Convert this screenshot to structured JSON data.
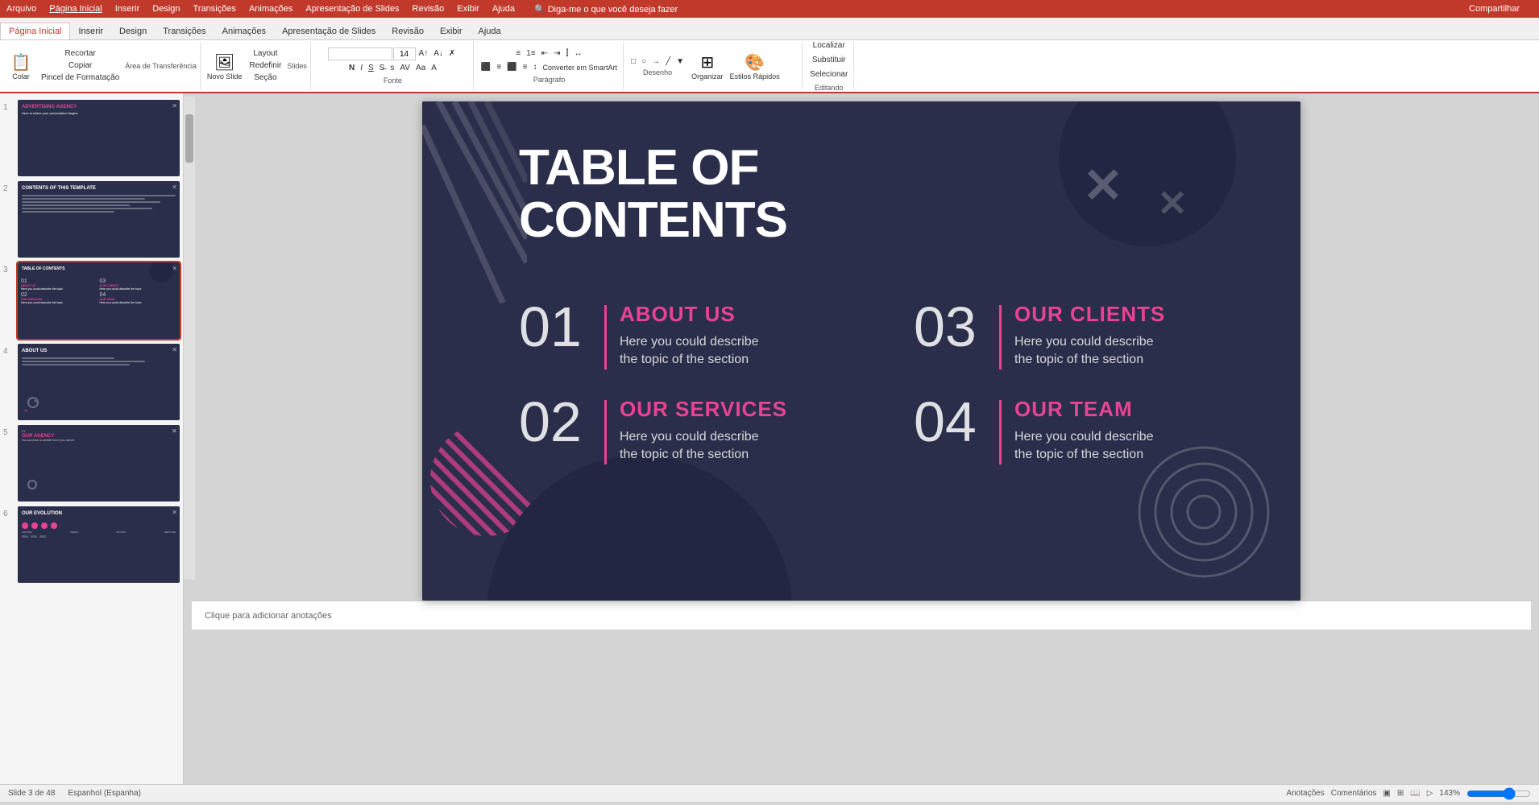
{
  "app": {
    "title": "PowerPoint",
    "menu_items": [
      "Arquivo",
      "Página Inicial",
      "Inserir",
      "Design",
      "Transições",
      "Animações",
      "Apresentação de Slides",
      "Revisão",
      "Exibir",
      "Ajuda",
      "Diga-me o que você deseja fazer"
    ],
    "share_label": "Compartilhar"
  },
  "ribbon": {
    "active_tab": "Página Inicial",
    "tabs": [
      "Arquivo",
      "Página Inicial",
      "Inserir",
      "Design",
      "Transições",
      "Animações",
      "Apresentação de Slides",
      "Revisão",
      "Exibir",
      "Ajuda"
    ],
    "clipboard": {
      "label": "Área de Transferência",
      "paste": "Colar",
      "cut": "Recortar",
      "copy": "Copiar",
      "format_painter": "Pincel de Formatação"
    },
    "slides": {
      "label": "Slides",
      "new_slide": "Novo Slide",
      "layout": "Layout",
      "reset": "Redefinir",
      "section": "Seção"
    },
    "font": {
      "label": "Fonte",
      "name": "",
      "size": "14",
      "bold": "N",
      "italic": "I",
      "underline": "S",
      "strikethrough": "S",
      "shadow": "s",
      "spacing": "Aa",
      "change_case": "Aa",
      "clear": "A",
      "color": "A"
    },
    "paragraph": {
      "label": "Parágrafo"
    },
    "drawing": {
      "label": "Desenho",
      "organize": "Organizar",
      "quick_styles": "Estilos Rápidos"
    },
    "editing": {
      "label": "Editando",
      "find": "Localizar",
      "replace": "Substituir",
      "select": "Selecionar"
    }
  },
  "slides": [
    {
      "number": "1",
      "title": "ADVERTISING AGENCY",
      "subtitle": "Here is where your presentation begins",
      "active": false
    },
    {
      "number": "2",
      "title": "CONTENTS OF THIS TEMPLATE",
      "active": false
    },
    {
      "number": "3",
      "title": "TABLE OF CONTENTS",
      "active": true
    },
    {
      "number": "4",
      "title": "ABOUT US",
      "active": false
    },
    {
      "number": "5",
      "title": "OUR AGENCY",
      "active": false
    },
    {
      "number": "6",
      "title": "OUR EVOLUTION",
      "active": false
    }
  ],
  "slide_main": {
    "title_line1": "TABLE OF",
    "title_line2": "CONTENTS",
    "items": [
      {
        "number": "01",
        "heading": "ABOUT US",
        "description_line1": "Here you could describe",
        "description_line2": "the topic of the section"
      },
      {
        "number": "02",
        "heading": "OUR SERVICES",
        "description_line1": "Here you could describe",
        "description_line2": "the topic of the section"
      },
      {
        "number": "03",
        "heading": "OUR CLIENTS",
        "description_line1": "Here you could describe",
        "description_line2": "the topic of the section"
      },
      {
        "number": "04",
        "heading": "OUR TEAM",
        "description_line1": "Here you could describe",
        "description_line2": "the topic of the section"
      }
    ]
  },
  "status_bar": {
    "slide_info": "Slide 3 de 48",
    "language": "Espanhol (Espanha)",
    "notes": "Anotações",
    "comments": "Comentários",
    "zoom": "143%",
    "cursor_x": "787",
    "cursor_y": "691"
  },
  "notes_placeholder": "Clique para adicionar anotações"
}
